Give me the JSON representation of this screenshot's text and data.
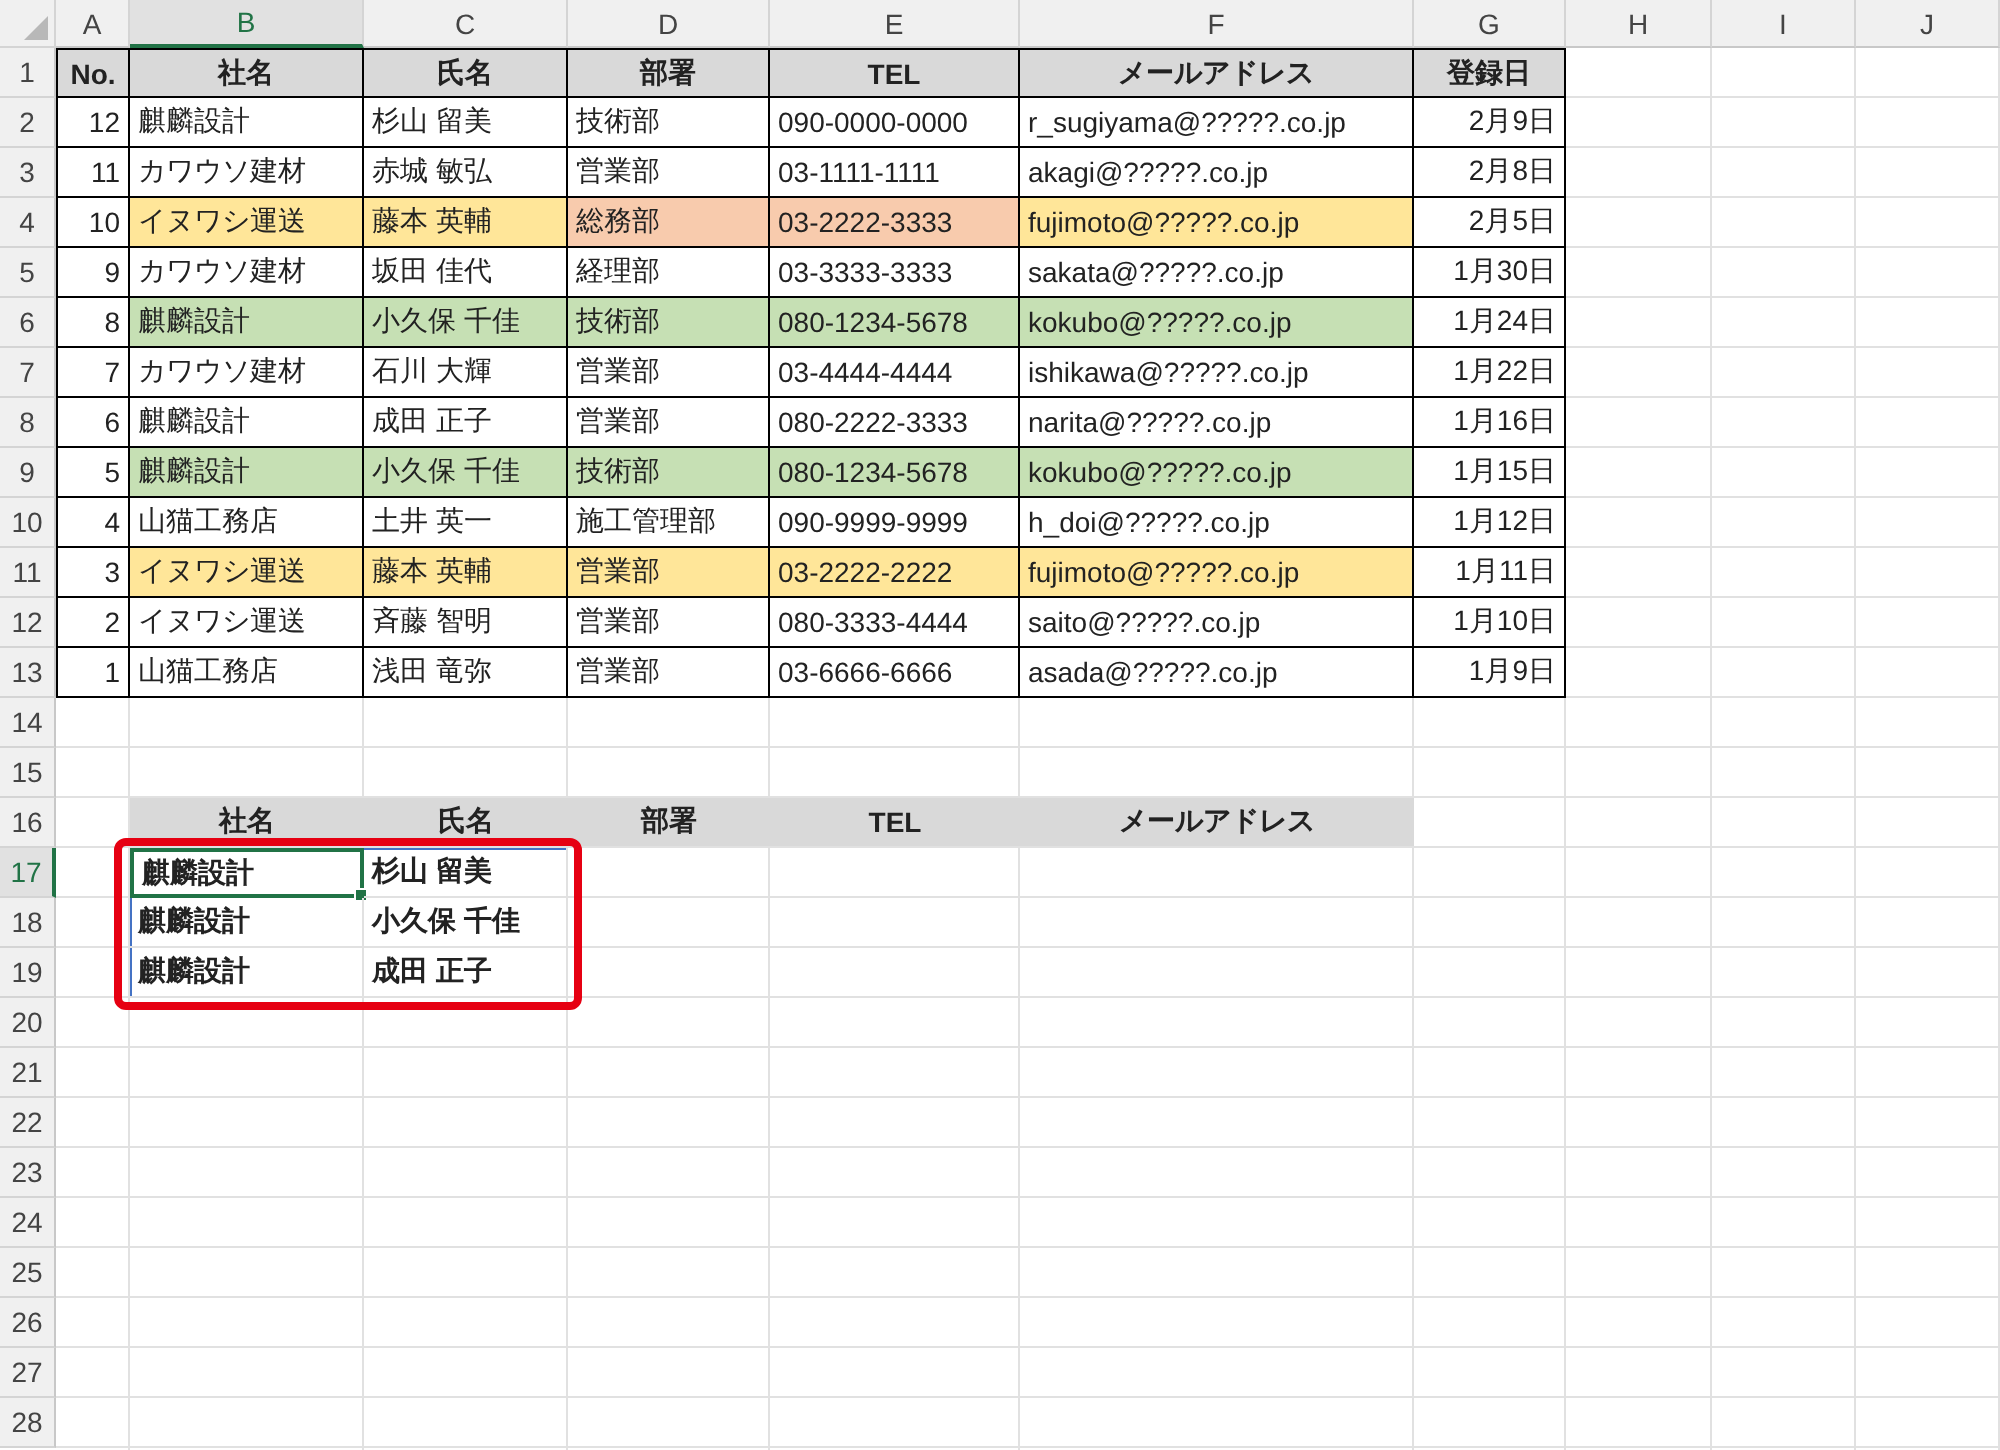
{
  "column_headers": [
    {
      "label": "A",
      "selected": false
    },
    {
      "label": "B",
      "selected": true
    },
    {
      "label": "C",
      "selected": false
    },
    {
      "label": "D",
      "selected": false
    },
    {
      "label": "E",
      "selected": false
    },
    {
      "label": "F",
      "selected": false
    },
    {
      "label": "G",
      "selected": false
    },
    {
      "label": "H",
      "selected": false
    },
    {
      "label": "I",
      "selected": false
    },
    {
      "label": "J",
      "selected": false
    }
  ],
  "row_headers": [
    {
      "label": "1",
      "selected": false
    },
    {
      "label": "2",
      "selected": false
    },
    {
      "label": "3",
      "selected": false
    },
    {
      "label": "4",
      "selected": false
    },
    {
      "label": "5",
      "selected": false
    },
    {
      "label": "6",
      "selected": false
    },
    {
      "label": "7",
      "selected": false
    },
    {
      "label": "8",
      "selected": false
    },
    {
      "label": "9",
      "selected": false
    },
    {
      "label": "10",
      "selected": false
    },
    {
      "label": "11",
      "selected": false
    },
    {
      "label": "12",
      "selected": false
    },
    {
      "label": "13",
      "selected": false
    },
    {
      "label": "14",
      "selected": false
    },
    {
      "label": "15",
      "selected": false
    },
    {
      "label": "16",
      "selected": false
    },
    {
      "label": "17",
      "selected": true
    },
    {
      "label": "18",
      "selected": false
    },
    {
      "label": "19",
      "selected": false
    },
    {
      "label": "20",
      "selected": false
    },
    {
      "label": "21",
      "selected": false
    },
    {
      "label": "22",
      "selected": false
    },
    {
      "label": "23",
      "selected": false
    },
    {
      "label": "24",
      "selected": false
    },
    {
      "label": "25",
      "selected": false
    },
    {
      "label": "26",
      "selected": false
    },
    {
      "label": "27",
      "selected": false
    },
    {
      "label": "28",
      "selected": false
    }
  ],
  "table": {
    "columns": [
      "No.",
      "社名",
      "氏名",
      "部署",
      "TEL",
      "メールアドレス",
      "登録日"
    ],
    "rows": [
      {
        "cells": [
          {
            "text": "12"
          },
          {
            "text": "麒麟設計"
          },
          {
            "text": "杉山 留美"
          },
          {
            "text": "技術部"
          },
          {
            "text": "090-0000-0000"
          },
          {
            "text": "r_sugiyama@?????.co.jp"
          },
          {
            "text": "2月9日"
          }
        ]
      },
      {
        "cells": [
          {
            "text": "11"
          },
          {
            "text": "カワウソ建材"
          },
          {
            "text": "赤城 敏弘"
          },
          {
            "text": "営業部"
          },
          {
            "text": "03-1111-1111"
          },
          {
            "text": "akagi@?????.co.jp"
          },
          {
            "text": "2月8日"
          }
        ]
      },
      {
        "cells": [
          {
            "text": "10"
          },
          {
            "text": "イヌワシ運送",
            "color": "#ffe699"
          },
          {
            "text": "藤本 英輔",
            "color": "#ffe699"
          },
          {
            "text": "総務部",
            "color": "#f8cbad"
          },
          {
            "text": "03-2222-3333",
            "color": "#f8cbad"
          },
          {
            "text": "fujimoto@?????.co.jp",
            "color": "#ffe699"
          },
          {
            "text": "2月5日"
          }
        ]
      },
      {
        "cells": [
          {
            "text": "9"
          },
          {
            "text": "カワウソ建材"
          },
          {
            "text": "坂田 佳代"
          },
          {
            "text": "経理部"
          },
          {
            "text": "03-3333-3333"
          },
          {
            "text": "sakata@?????.co.jp"
          },
          {
            "text": "1月30日"
          }
        ]
      },
      {
        "cells": [
          {
            "text": "8"
          },
          {
            "text": "麒麟設計",
            "color": "#c6e0b4"
          },
          {
            "text": "小久保 千佳",
            "color": "#c6e0b4"
          },
          {
            "text": "技術部",
            "color": "#c6e0b4"
          },
          {
            "text": "080-1234-5678",
            "color": "#c6e0b4"
          },
          {
            "text": "kokubo@?????.co.jp",
            "color": "#c6e0b4"
          },
          {
            "text": "1月24日"
          }
        ]
      },
      {
        "cells": [
          {
            "text": "7"
          },
          {
            "text": "カワウソ建材"
          },
          {
            "text": "石川 大輝"
          },
          {
            "text": "営業部"
          },
          {
            "text": "03-4444-4444"
          },
          {
            "text": "ishikawa@?????.co.jp"
          },
          {
            "text": "1月22日"
          }
        ]
      },
      {
        "cells": [
          {
            "text": "6"
          },
          {
            "text": "麒麟設計"
          },
          {
            "text": "成田 正子"
          },
          {
            "text": "営業部"
          },
          {
            "text": "080-2222-3333"
          },
          {
            "text": "narita@?????.co.jp"
          },
          {
            "text": "1月16日"
          }
        ]
      },
      {
        "cells": [
          {
            "text": "5"
          },
          {
            "text": "麒麟設計",
            "color": "#c6e0b4"
          },
          {
            "text": "小久保 千佳",
            "color": "#c6e0b4"
          },
          {
            "text": "技術部",
            "color": "#c6e0b4"
          },
          {
            "text": "080-1234-5678",
            "color": "#c6e0b4"
          },
          {
            "text": "kokubo@?????.co.jp",
            "color": "#c6e0b4"
          },
          {
            "text": "1月15日"
          }
        ]
      },
      {
        "cells": [
          {
            "text": "4"
          },
          {
            "text": "山猫工務店"
          },
          {
            "text": "土井 英一"
          },
          {
            "text": "施工管理部"
          },
          {
            "text": "090-9999-9999"
          },
          {
            "text": "h_doi@?????.co.jp"
          },
          {
            "text": "1月12日"
          }
        ]
      },
      {
        "cells": [
          {
            "text": "3"
          },
          {
            "text": "イヌワシ運送",
            "color": "#ffe699"
          },
          {
            "text": "藤本 英輔",
            "color": "#ffe699"
          },
          {
            "text": "営業部",
            "color": "#ffe699"
          },
          {
            "text": "03-2222-2222",
            "color": "#ffe699"
          },
          {
            "text": "fujimoto@?????.co.jp",
            "color": "#ffe699"
          },
          {
            "text": "1月11日"
          }
        ]
      },
      {
        "cells": [
          {
            "text": "2"
          },
          {
            "text": "イヌワシ運送"
          },
          {
            "text": "斉藤 智明"
          },
          {
            "text": "営業部"
          },
          {
            "text": "080-3333-4444"
          },
          {
            "text": "saito@?????.co.jp"
          },
          {
            "text": "1月10日"
          }
        ]
      },
      {
        "cells": [
          {
            "text": "1"
          },
          {
            "text": "山猫工務店"
          },
          {
            "text": "浅田 竜弥"
          },
          {
            "text": "営業部"
          },
          {
            "text": "03-6666-6666"
          },
          {
            "text": "asada@?????.co.jp"
          },
          {
            "text": "1月9日"
          }
        ]
      }
    ]
  },
  "result": {
    "highlighted": true,
    "columns": [
      "社名",
      "氏名",
      "部署",
      "TEL",
      "メールアドレス"
    ],
    "rows": [
      {
        "cells": [
          {
            "text": "麒麟設計",
            "selected": true
          },
          {
            "text": "杉山 留美",
            "selected": false
          }
        ]
      },
      {
        "cells": [
          {
            "text": "麒麟設計",
            "selected": false
          },
          {
            "text": "小久保 千佳",
            "selected": false
          }
        ]
      },
      {
        "cells": [
          {
            "text": "麒麟設計",
            "selected": false
          },
          {
            "text": "成田 正子",
            "selected": false
          }
        ]
      }
    ]
  }
}
